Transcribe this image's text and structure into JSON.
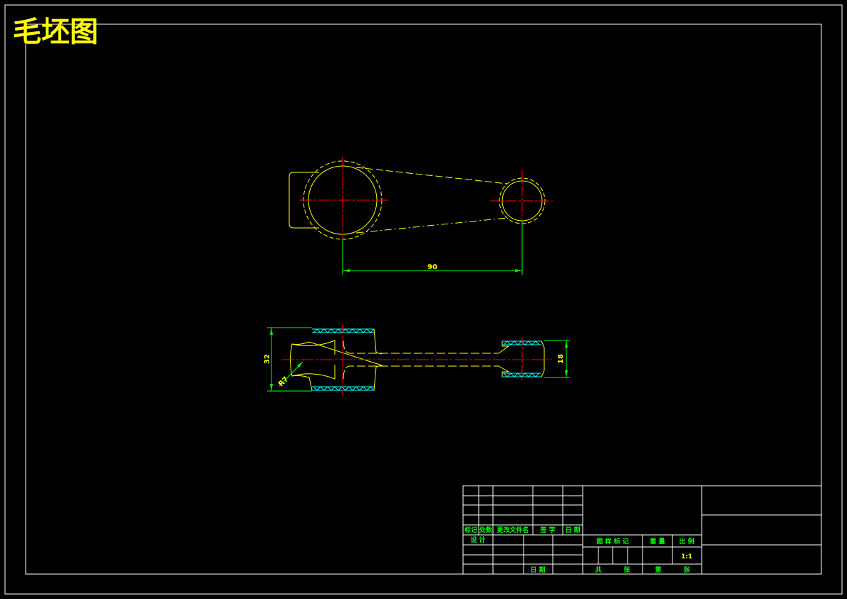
{
  "title": "毛坯图",
  "colors": {
    "background": "#000000",
    "frame": "#ffffff",
    "outline": "#ffff00",
    "centerline": "#ff0000",
    "dimension": "#00ff00",
    "hatch": "#00ffff",
    "title": "#ffff00"
  },
  "dimensions": {
    "center_distance": "90",
    "height_left": "32",
    "height_right": "18",
    "radius": "R7"
  },
  "title_block": {
    "h_mark": "标记",
    "h_count": "处数",
    "h_docno": "更改文件名",
    "h_sign": "签 字",
    "h_date": "日 期",
    "design": "设 计",
    "date": "日 期",
    "stage_mark": "图 样 标 记",
    "weight": "重 量",
    "scale": "比 例",
    "scale_value": "1:1",
    "sheets_total": "共",
    "sheets_unit": "张",
    "sheet_no": "第",
    "sheet_unit": "张"
  }
}
